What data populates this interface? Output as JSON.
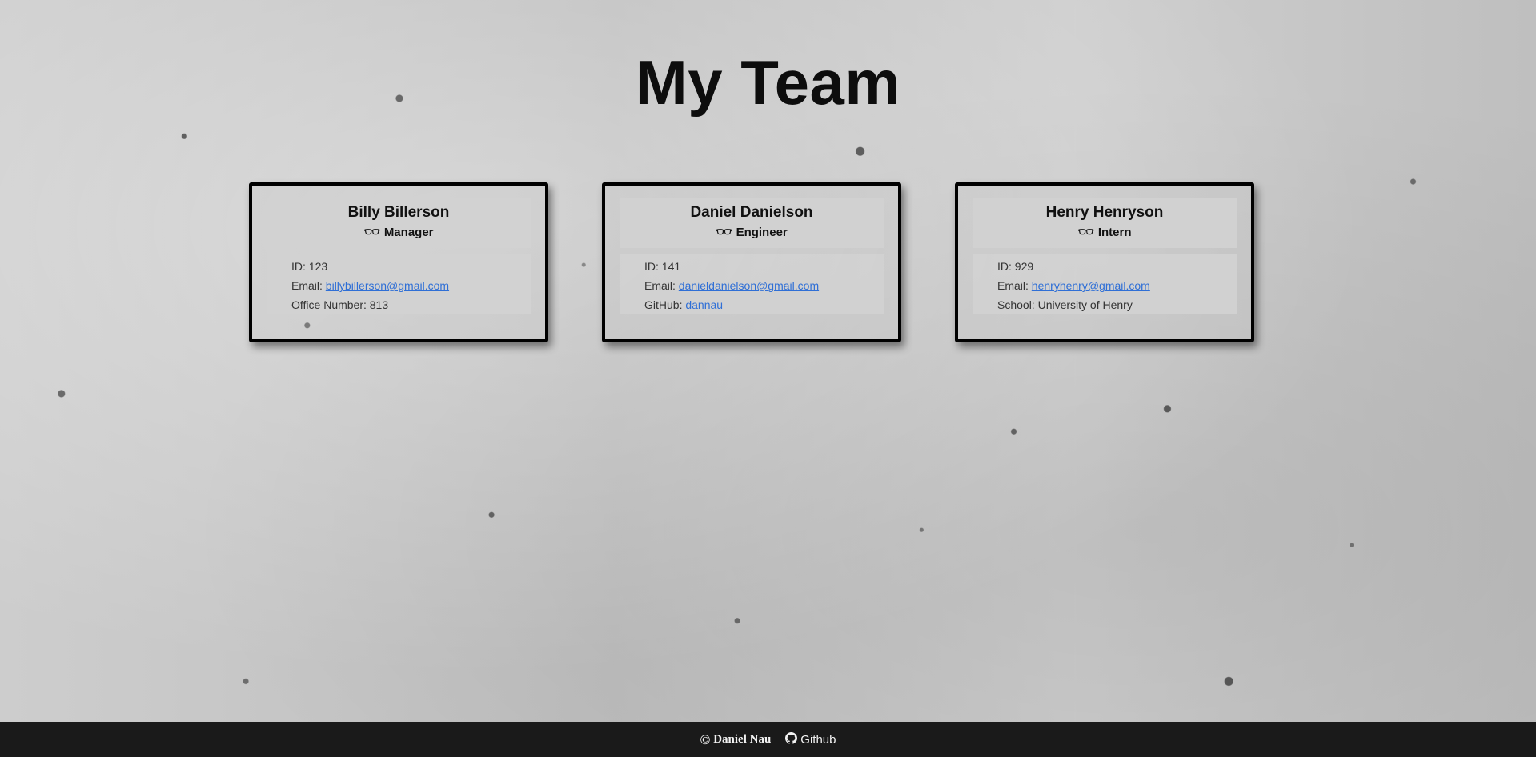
{
  "page": {
    "title": "My Team"
  },
  "cards": [
    {
      "name": "Billy Billerson",
      "role_icon": "glasses-icon",
      "role": "Manager",
      "id_label": "ID: 123",
      "email_prefix": "Email: ",
      "email": "billybillerson@gmail.com",
      "extra_prefix": "Office Number: 813",
      "extra_link": ""
    },
    {
      "name": "Daniel Danielson",
      "role_icon": "glasses-icon",
      "role": "Engineer",
      "id_label": "ID: 141",
      "email_prefix": "Email: ",
      "email": "danieldanielson@gmail.com",
      "extra_prefix": "GitHub: ",
      "extra_link": "dannau"
    },
    {
      "name": "Henry Henryson",
      "role_icon": "glasses-icon",
      "role": "Intern",
      "id_label": "ID: 929",
      "email_prefix": "Email: ",
      "email": "henryhenry@gmail.com",
      "extra_prefix": "School: University of Henry",
      "extra_link": ""
    }
  ],
  "footer": {
    "copyright_icon": "copyright-icon",
    "copyright_text": "Daniel Nau",
    "github_icon": "github-icon",
    "github_label": "Github"
  },
  "colors": {
    "link": "#2f6fd6",
    "footer_bg": "#1a1a1a"
  }
}
